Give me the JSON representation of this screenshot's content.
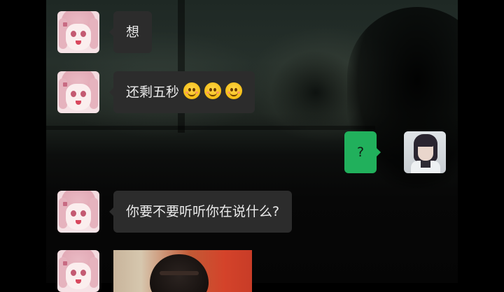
{
  "chat": {
    "messages": [
      {
        "sender": "other",
        "text": "想"
      },
      {
        "sender": "other",
        "text": "还剩五秒",
        "emoji": [
          "grinning-face",
          "grinning-face",
          "grinning-face"
        ]
      },
      {
        "sender": "me",
        "text": "?"
      },
      {
        "sender": "other",
        "text": "你要不要听听你在说什么?"
      },
      {
        "sender": "other",
        "type": "image"
      }
    ]
  },
  "colors": {
    "incoming_bubble": "#2c2c2c",
    "outgoing_bubble": "#21b05c",
    "incoming_text": "#ebebeb"
  }
}
